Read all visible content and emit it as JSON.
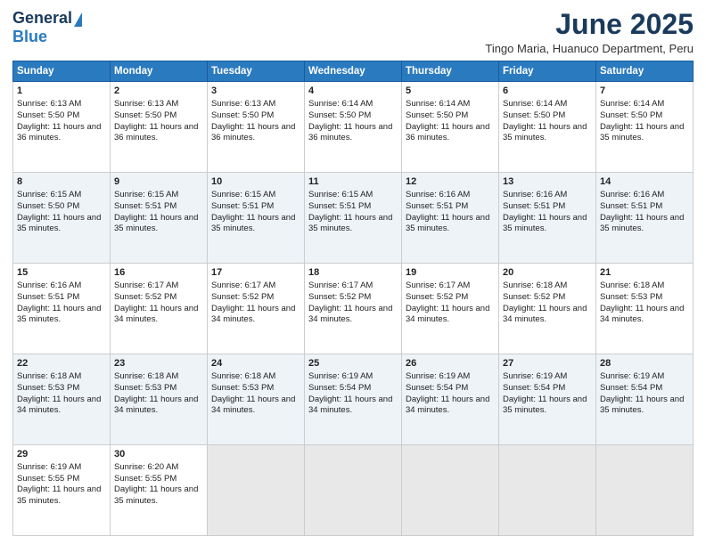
{
  "logo": {
    "line1": "General",
    "line2": "Blue"
  },
  "title": "June 2025",
  "subtitle": "Tingo Maria, Huanuco Department, Peru",
  "days_of_week": [
    "Sunday",
    "Monday",
    "Tuesday",
    "Wednesday",
    "Thursday",
    "Friday",
    "Saturday"
  ],
  "weeks": [
    [
      {
        "day": "1",
        "sunrise": "6:13 AM",
        "sunset": "5:50 PM",
        "daylight": "11 hours and 36 minutes."
      },
      {
        "day": "2",
        "sunrise": "6:13 AM",
        "sunset": "5:50 PM",
        "daylight": "11 hours and 36 minutes."
      },
      {
        "day": "3",
        "sunrise": "6:13 AM",
        "sunset": "5:50 PM",
        "daylight": "11 hours and 36 minutes."
      },
      {
        "day": "4",
        "sunrise": "6:14 AM",
        "sunset": "5:50 PM",
        "daylight": "11 hours and 36 minutes."
      },
      {
        "day": "5",
        "sunrise": "6:14 AM",
        "sunset": "5:50 PM",
        "daylight": "11 hours and 36 minutes."
      },
      {
        "day": "6",
        "sunrise": "6:14 AM",
        "sunset": "5:50 PM",
        "daylight": "11 hours and 35 minutes."
      },
      {
        "day": "7",
        "sunrise": "6:14 AM",
        "sunset": "5:50 PM",
        "daylight": "11 hours and 35 minutes."
      }
    ],
    [
      {
        "day": "8",
        "sunrise": "6:15 AM",
        "sunset": "5:50 PM",
        "daylight": "11 hours and 35 minutes."
      },
      {
        "day": "9",
        "sunrise": "6:15 AM",
        "sunset": "5:51 PM",
        "daylight": "11 hours and 35 minutes."
      },
      {
        "day": "10",
        "sunrise": "6:15 AM",
        "sunset": "5:51 PM",
        "daylight": "11 hours and 35 minutes."
      },
      {
        "day": "11",
        "sunrise": "6:15 AM",
        "sunset": "5:51 PM",
        "daylight": "11 hours and 35 minutes."
      },
      {
        "day": "12",
        "sunrise": "6:16 AM",
        "sunset": "5:51 PM",
        "daylight": "11 hours and 35 minutes."
      },
      {
        "day": "13",
        "sunrise": "6:16 AM",
        "sunset": "5:51 PM",
        "daylight": "11 hours and 35 minutes."
      },
      {
        "day": "14",
        "sunrise": "6:16 AM",
        "sunset": "5:51 PM",
        "daylight": "11 hours and 35 minutes."
      }
    ],
    [
      {
        "day": "15",
        "sunrise": "6:16 AM",
        "sunset": "5:51 PM",
        "daylight": "11 hours and 35 minutes."
      },
      {
        "day": "16",
        "sunrise": "6:17 AM",
        "sunset": "5:52 PM",
        "daylight": "11 hours and 34 minutes."
      },
      {
        "day": "17",
        "sunrise": "6:17 AM",
        "sunset": "5:52 PM",
        "daylight": "11 hours and 34 minutes."
      },
      {
        "day": "18",
        "sunrise": "6:17 AM",
        "sunset": "5:52 PM",
        "daylight": "11 hours and 34 minutes."
      },
      {
        "day": "19",
        "sunrise": "6:17 AM",
        "sunset": "5:52 PM",
        "daylight": "11 hours and 34 minutes."
      },
      {
        "day": "20",
        "sunrise": "6:18 AM",
        "sunset": "5:52 PM",
        "daylight": "11 hours and 34 minutes."
      },
      {
        "day": "21",
        "sunrise": "6:18 AM",
        "sunset": "5:53 PM",
        "daylight": "11 hours and 34 minutes."
      }
    ],
    [
      {
        "day": "22",
        "sunrise": "6:18 AM",
        "sunset": "5:53 PM",
        "daylight": "11 hours and 34 minutes."
      },
      {
        "day": "23",
        "sunrise": "6:18 AM",
        "sunset": "5:53 PM",
        "daylight": "11 hours and 34 minutes."
      },
      {
        "day": "24",
        "sunrise": "6:18 AM",
        "sunset": "5:53 PM",
        "daylight": "11 hours and 34 minutes."
      },
      {
        "day": "25",
        "sunrise": "6:19 AM",
        "sunset": "5:54 PM",
        "daylight": "11 hours and 34 minutes."
      },
      {
        "day": "26",
        "sunrise": "6:19 AM",
        "sunset": "5:54 PM",
        "daylight": "11 hours and 34 minutes."
      },
      {
        "day": "27",
        "sunrise": "6:19 AM",
        "sunset": "5:54 PM",
        "daylight": "11 hours and 35 minutes."
      },
      {
        "day": "28",
        "sunrise": "6:19 AM",
        "sunset": "5:54 PM",
        "daylight": "11 hours and 35 minutes."
      }
    ],
    [
      {
        "day": "29",
        "sunrise": "6:19 AM",
        "sunset": "5:55 PM",
        "daylight": "11 hours and 35 minutes."
      },
      {
        "day": "30",
        "sunrise": "6:20 AM",
        "sunset": "5:55 PM",
        "daylight": "11 hours and 35 minutes."
      },
      null,
      null,
      null,
      null,
      null
    ]
  ]
}
